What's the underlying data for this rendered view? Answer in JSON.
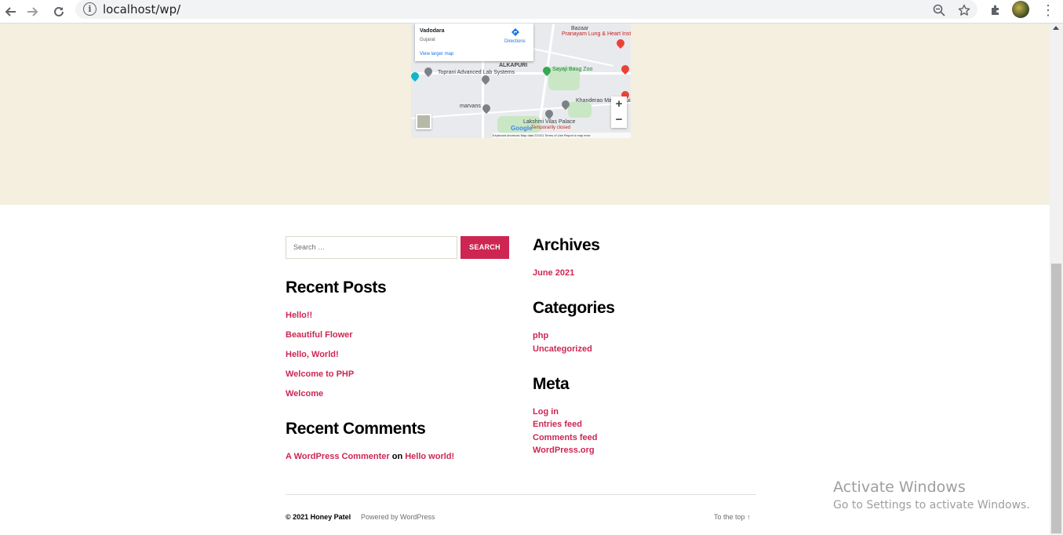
{
  "browser": {
    "url": "localhost/wp/",
    "back_icon": "back-arrow-icon",
    "forward_icon": "forward-arrow-icon",
    "reload_icon": "reload-icon"
  },
  "map": {
    "place_name": "Vadodara",
    "region": "Gujarat",
    "directions_label": "Directions",
    "view_larger": "View larger map",
    "labels": [
      "Pranayam Lung & Heart Institute",
      "Sayaji Baug Zoo",
      "Toprani Advanced Lab Systems",
      "ALKAPURI",
      "Khanderao Market Building",
      "Lakshmi Vilas Palace",
      "Temporarily closed",
      "marvans",
      "Bazaar"
    ],
    "zoom_in": "+",
    "zoom_out": "−",
    "footer": "Keyboard shortcuts   Map data ©2021   Terms of Use   Report a map error",
    "logo": "Google"
  },
  "search": {
    "placeholder": "Search …",
    "button_label": "SEARCH"
  },
  "recent_posts": {
    "title": "Recent Posts",
    "items": [
      "Hello!!",
      "Beautiful Flower",
      "Hello, World!",
      "Welcome to PHP",
      "Welcome"
    ]
  },
  "recent_comments": {
    "title": "Recent Comments",
    "author": "A WordPress Commenter",
    "on": "on",
    "post": "Hello world!"
  },
  "archives": {
    "title": "Archives",
    "items": [
      "June 2021"
    ]
  },
  "categories": {
    "title": "Categories",
    "items": [
      "php",
      "Uncategorized"
    ]
  },
  "meta": {
    "title": "Meta",
    "items": [
      "Log in",
      "Entries feed",
      "Comments feed",
      "WordPress.org"
    ]
  },
  "footer": {
    "copyright": "© 2021 Honey Patel",
    "powered": "Powered by WordPress",
    "to_top": "To the top ↑"
  },
  "watermark": {
    "line1": "Activate Windows",
    "line2": "Go to Settings to activate Windows."
  },
  "colors": {
    "accent": "#cd2653",
    "cream": "#f5efe0"
  }
}
